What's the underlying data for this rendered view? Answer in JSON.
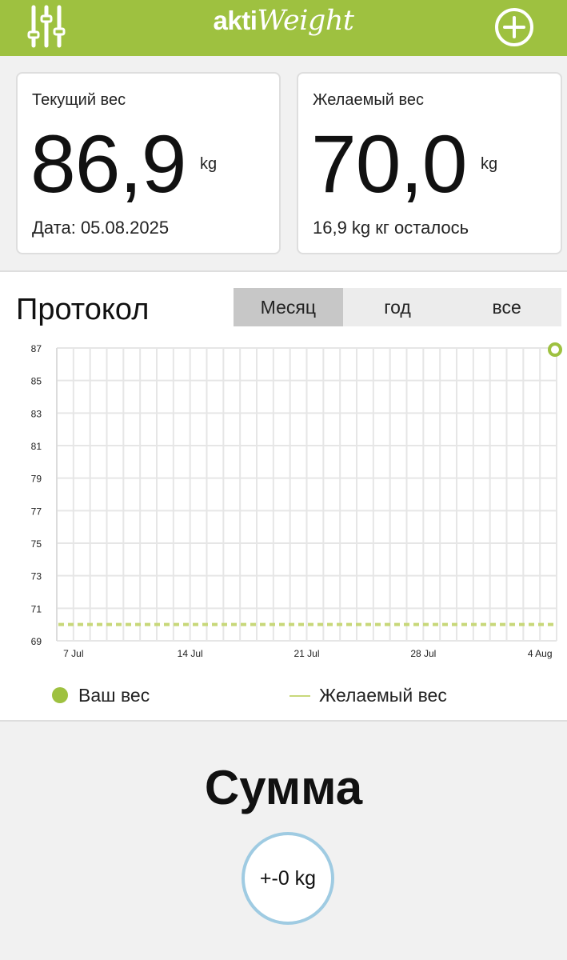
{
  "header": {
    "brand_left": "akti",
    "brand_right": "Weight",
    "menu_icon": "sliders-icon",
    "add_icon": "plus-circle-icon",
    "bar_color": "#9ec140"
  },
  "cards": {
    "current": {
      "label": "Текущий вес",
      "value": "86,9",
      "unit": "kg",
      "sub": "Дата: 05.08.2025"
    },
    "target": {
      "label": "Желаемый вес",
      "value": "70,0",
      "unit": "kg",
      "sub": "16,9 kg кг осталось"
    }
  },
  "protocol": {
    "title": "Протокол",
    "tabs": [
      {
        "label": "Месяц",
        "active": true
      },
      {
        "label": "год",
        "active": false
      },
      {
        "label": "все",
        "active": false
      }
    ]
  },
  "chart_data": {
    "type": "line",
    "x_ticks": [
      "7 Jul",
      "14 Jul",
      "21 Jul",
      "28 Jul",
      "4 Aug"
    ],
    "y_ticks": [
      87,
      85,
      83,
      81,
      79,
      77,
      75,
      73,
      71,
      69
    ],
    "ylim": [
      69,
      87
    ],
    "x_range": [
      "2025-07-06",
      "2025-08-05"
    ],
    "series": [
      {
        "name": "Ваш вес",
        "color": "#9ec140",
        "points": [
          {
            "x": "2025-08-05",
            "y": 86.9
          }
        ]
      },
      {
        "name": "Желаемый вес",
        "color": "#c8d87a",
        "style": "dashed",
        "value": 70.0
      }
    ],
    "grid": true,
    "legend": "bottom"
  },
  "summary": {
    "title": "Сумма",
    "value": "+-0 kg"
  }
}
